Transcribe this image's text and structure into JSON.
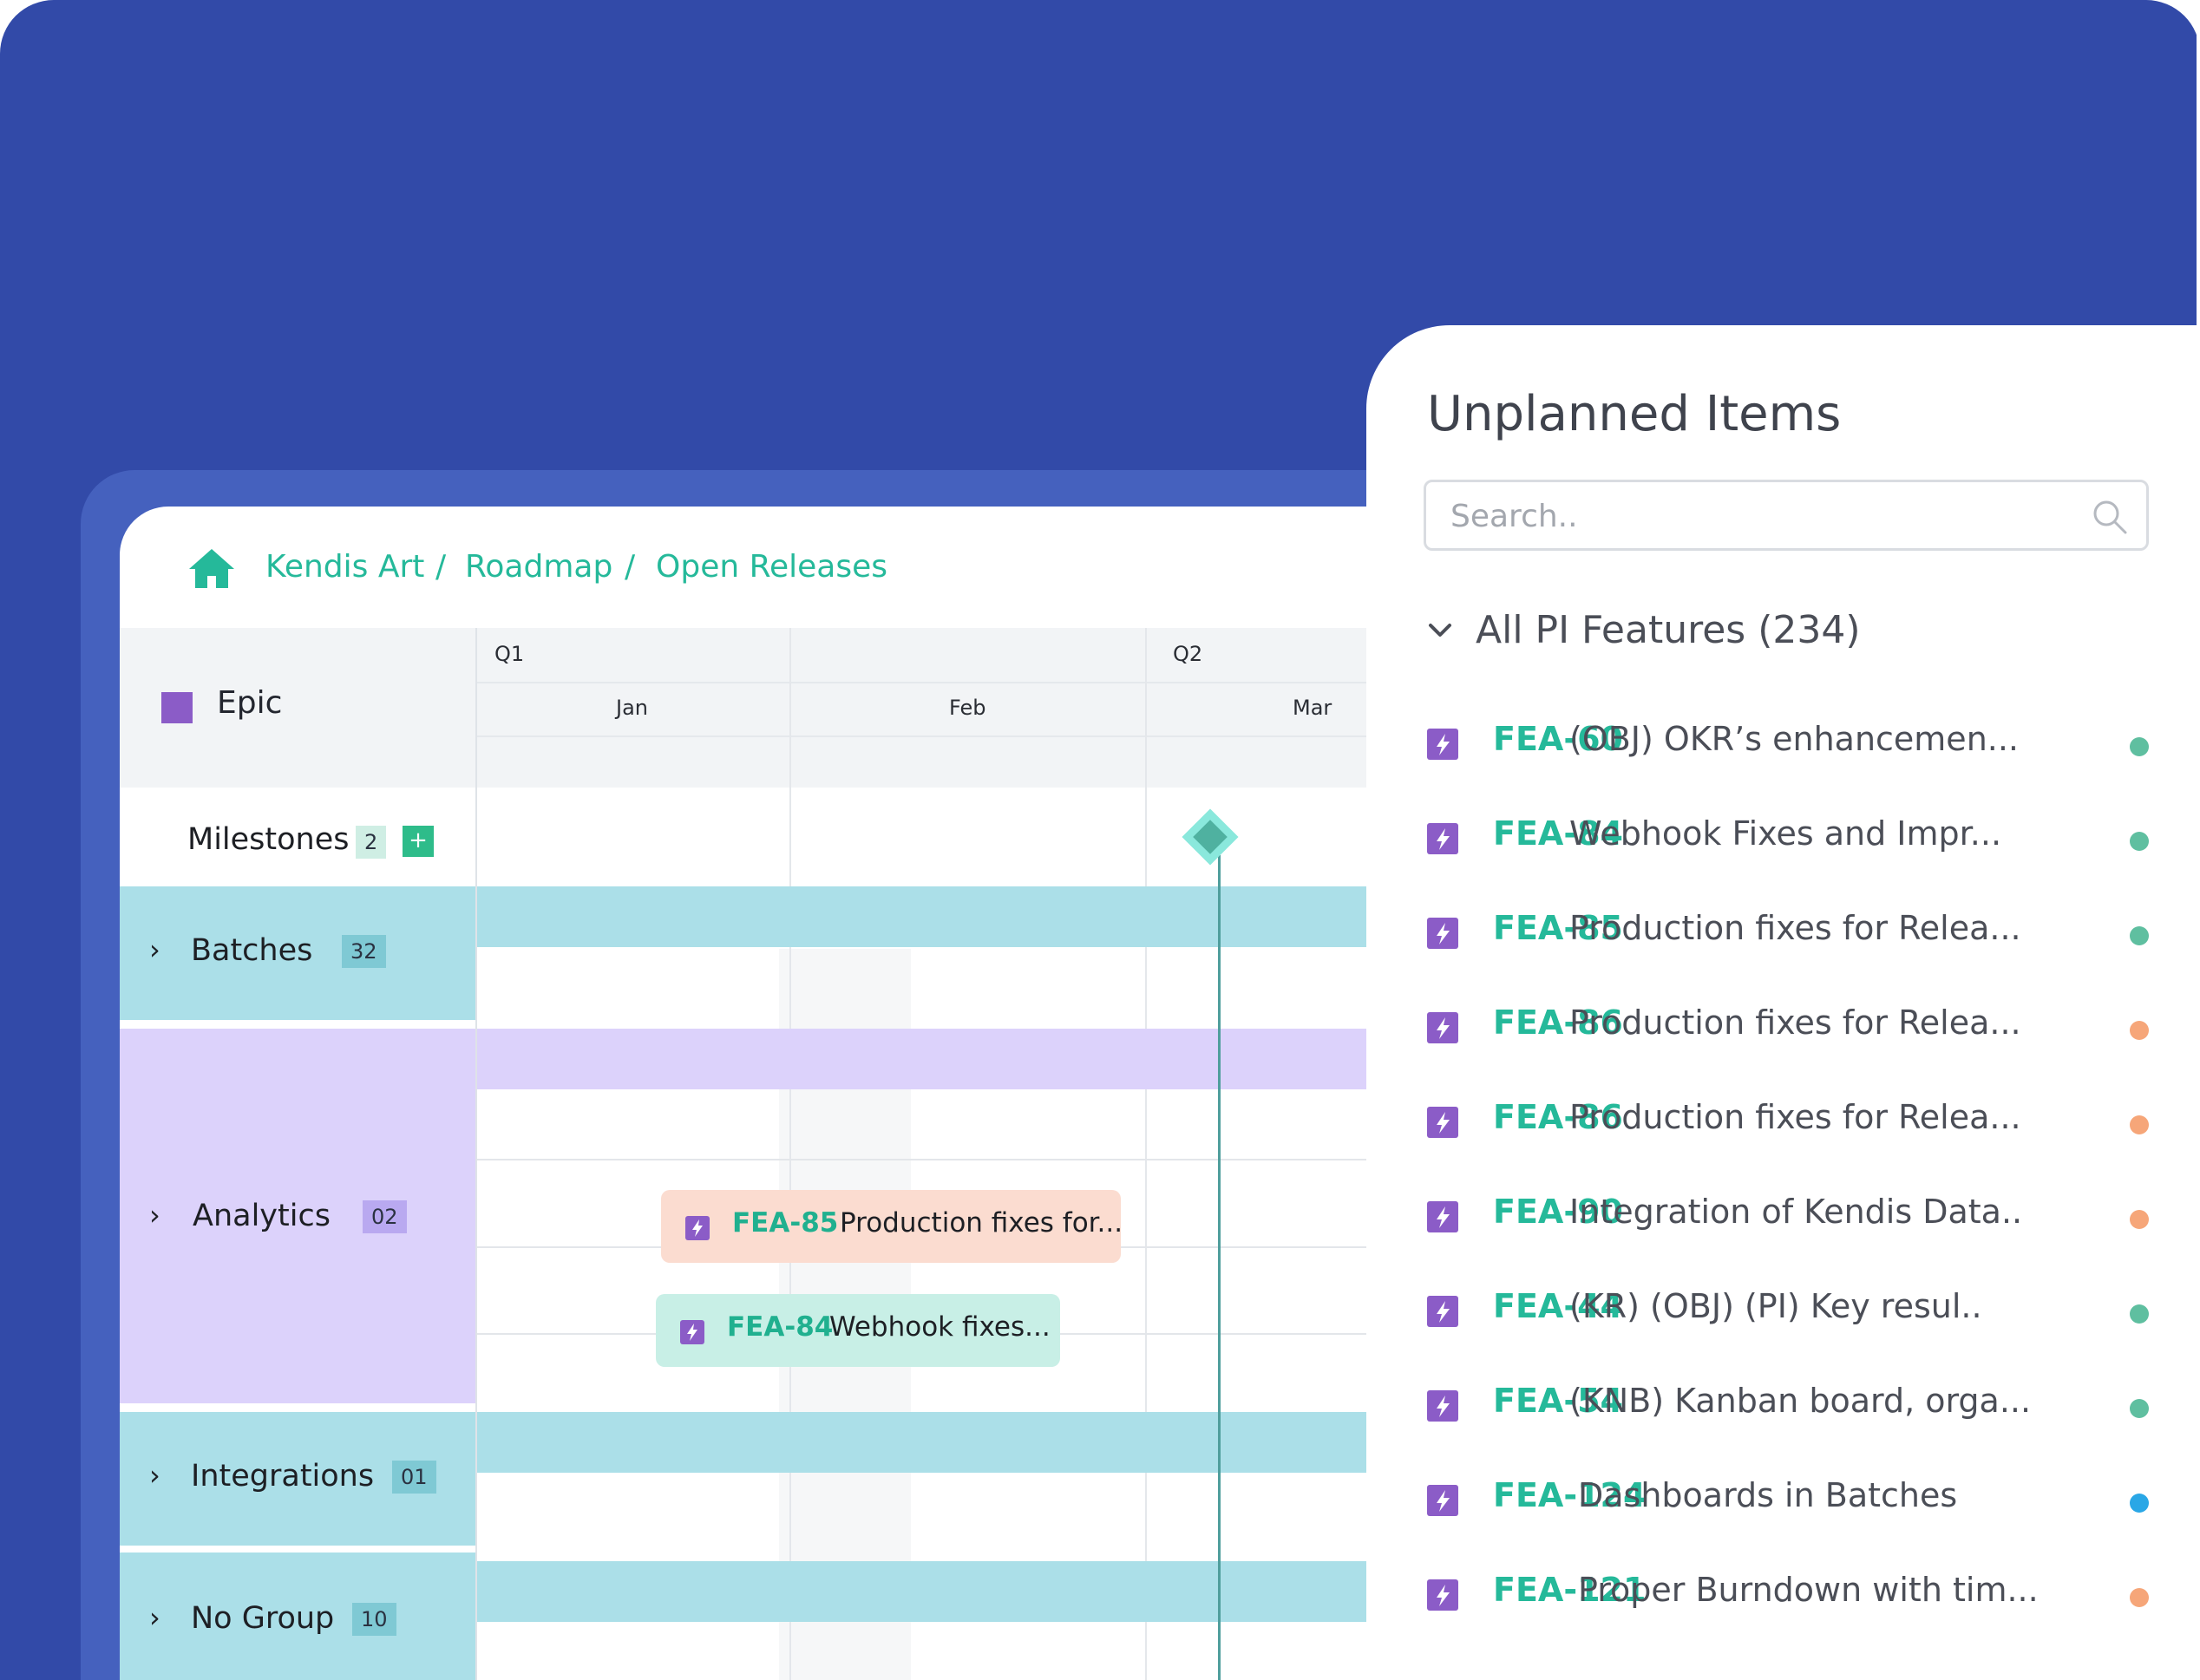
{
  "breadcrumb": [
    "Kendis Art",
    "Roadmap",
    "Open Releases"
  ],
  "epic_label": "Epic",
  "milestones": {
    "label": "Milestones",
    "count": "2",
    "add": "+"
  },
  "quarters": [
    "Q1",
    "Q2"
  ],
  "months": [
    "Jan",
    "Feb",
    "Mar"
  ],
  "groups": [
    {
      "label": "Batches",
      "count": "32",
      "color": "#abdfe8"
    },
    {
      "label": "Analytics",
      "count": "02",
      "color": "#dcd2fb"
    },
    {
      "label": "Integrations",
      "count": "01",
      "color": "#abdfe8"
    },
    {
      "label": "No Group",
      "count": "10",
      "color": "#abdfe8"
    }
  ],
  "chips": [
    {
      "key": "FEA-85",
      "text": "Production fixes for...",
      "color": "#fbdcd0"
    },
    {
      "key": "FEA-84",
      "text": "Webhook fixes...",
      "color": "#c8efe6"
    }
  ],
  "panel": {
    "title": "Unplanned Items",
    "search_placeholder": "Search..",
    "group_label": "All PI Features (234)",
    "items": [
      {
        "key": "FEA-60",
        "text": "(OBJ) OKR’s enhancemen...",
        "status_color": "#5fbfa0"
      },
      {
        "key": "FEA-84",
        "text": "Webhook Fixes and Impr...",
        "status_color": "#5fbfa0"
      },
      {
        "key": "FEA-85",
        "text": "Production fixes for Relea...",
        "status_color": "#5fbfa0"
      },
      {
        "key": "FEA-86",
        "text": "Production fixes for Relea...",
        "status_color": "#f6a679"
      },
      {
        "key": "FEA-86",
        "text": "Production fixes for Relea...",
        "status_color": "#f6a679"
      },
      {
        "key": "FEA-90",
        "text": "Integration of Kendis Data..",
        "status_color": "#f6a679"
      },
      {
        "key": "FEA-44",
        "text": "(KR) (OBJ) (PI) Key resul..",
        "status_color": "#5fbfa0"
      },
      {
        "key": "FEA-54",
        "text": "(KNB) Kanban board, orga...",
        "status_color": "#5fbfa0"
      },
      {
        "key": "FEA-124",
        "text": "Dashboards in Batches",
        "status_color": "#2aa7e6"
      },
      {
        "key": "FEA-121",
        "text": "Proper Burndown with tim...",
        "status_color": "#f6a679"
      }
    ]
  },
  "colors": {
    "accent": "#25b99a",
    "brand": "#324aa8",
    "feature_icon": "#8b5cc7"
  }
}
